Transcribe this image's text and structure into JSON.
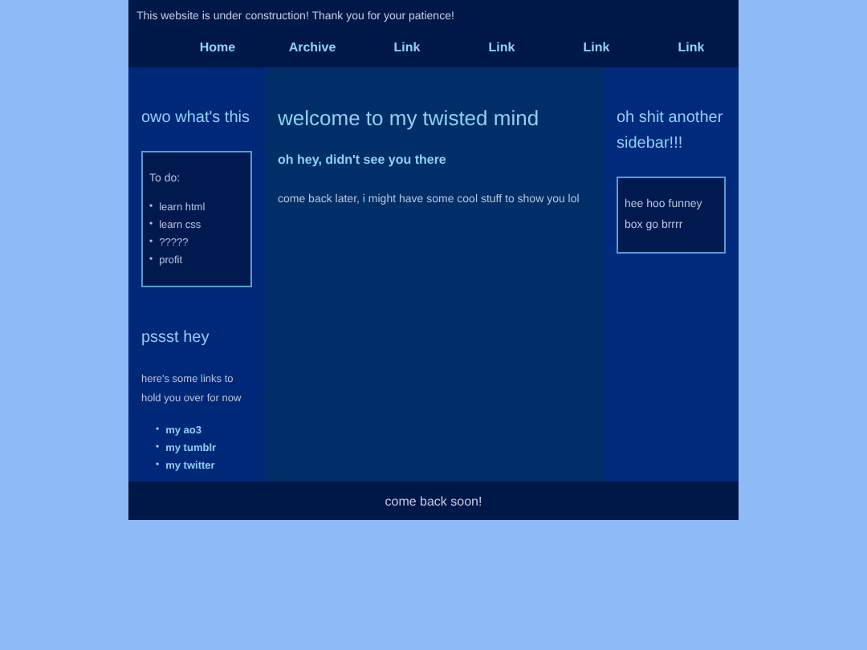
{
  "notice": "This website is under construction! Thank you for your patience!",
  "nav": [
    "Home",
    "Archive",
    "Link",
    "Link",
    "Link",
    "Link"
  ],
  "left_sidebar": {
    "title": "owo what's this",
    "box": {
      "heading": "To do:",
      "bullet": "•",
      "items": [
        "learn html",
        "learn css",
        "?????",
        "profit"
      ]
    },
    "section_title": "pssst hey",
    "text": "here's some links to hold you over for now",
    "link_bullet": "•",
    "links": [
      "my ao3",
      "my tumblr",
      "my twitter"
    ]
  },
  "main": {
    "title": "welcome to my twisted mind",
    "subtitle": "oh hey, didn't see you there",
    "text": "come back later, i might have some cool stuff to show you lol"
  },
  "right_sidebar": {
    "title": "oh shit another sidebar!!!",
    "box_text": "hee hoo funney box go brrrr"
  },
  "footer": "come back soon!"
}
